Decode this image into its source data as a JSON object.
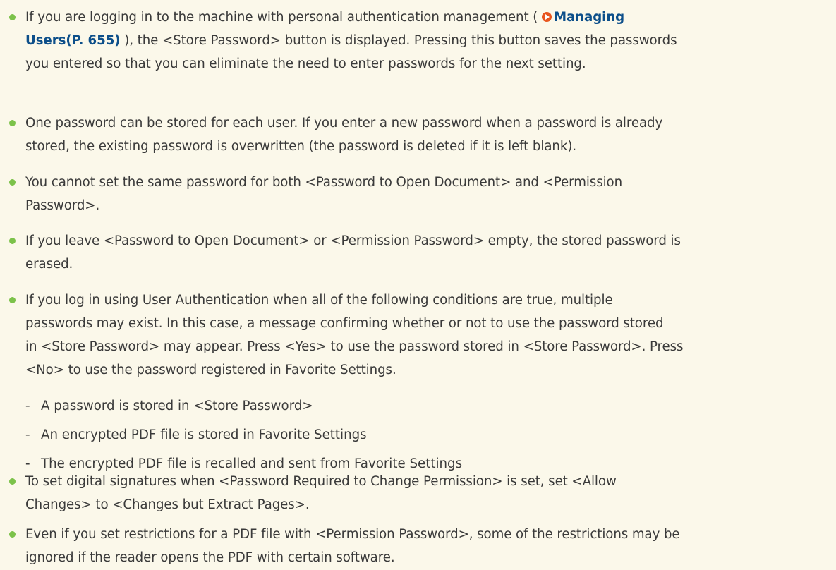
{
  "notes": {
    "item1": {
      "pre": "If you are logging in to the machine with personal authentication management (",
      "link_part1": "Managing",
      "link_part2": "Users(P. 655)",
      "line2_post": "), the <Store Password> button is displayed. Pressing this button saves the passwords",
      "line3": "you entered so that you can eliminate the need to enter passwords for the next setting."
    },
    "item2": {
      "line1": "One password can be stored for each user. If you enter a new password when a password is already",
      "line2": "stored, the existing password is overwritten (the password is deleted if it is left blank)."
    },
    "item3": {
      "line1": "You cannot set the same password for both <Password to Open Document> and <Permission",
      "line2": "Password>."
    },
    "item4": {
      "line1": "If you leave <Password to Open Document> or <Permission Password> empty, the stored password is",
      "line2": "erased."
    },
    "item5": {
      "line1": "If you log in using User Authentication when all of the following conditions are true, multiple",
      "line2": "passwords may exist. In this case, a message confirming whether or not to use the password stored",
      "line3": "in <Store Password> may appear. Press <Yes> to use the password stored in <Store Password>. Press",
      "line4": "<No> to use the password registered in Favorite Settings.",
      "sub1": "A password is stored in <Store Password>",
      "sub2": "An encrypted PDF file is stored in Favorite Settings",
      "sub3": "The encrypted PDF file is recalled and sent from Favorite Settings"
    },
    "item6": {
      "line1": "To set digital signatures when <Password Required to Change Permission> is set, set <Allow",
      "line2": "Changes> to <Changes but Extract Pages>."
    },
    "item7": {
      "line1": "Even if you set restrictions for a PDF file with <Permission Password>, some of the restrictions may be",
      "line2": "ignored if the reader opens the PDF with certain software."
    },
    "sub_dash": "-"
  },
  "colors": {
    "background": "#fbf8ea",
    "bullet": "#7cc24a",
    "link": "#0d4f8a",
    "link_icon": "#e8561f",
    "text": "#3a3a3a"
  }
}
